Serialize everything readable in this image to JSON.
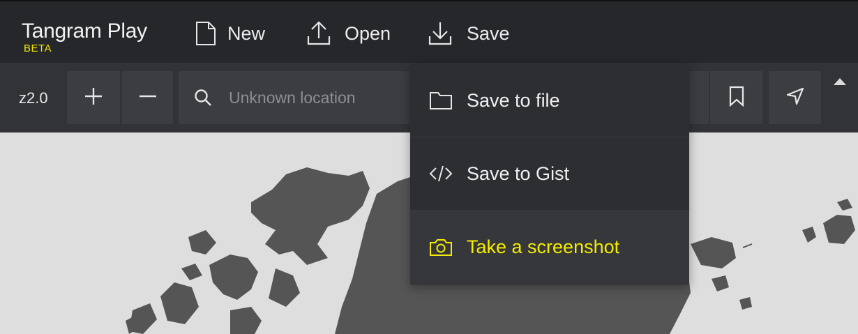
{
  "app": {
    "title": "Tangram Play",
    "badge": "BETA"
  },
  "menu": {
    "new_label": "New",
    "open_label": "Open",
    "save_label": "Save"
  },
  "toolbar": {
    "zoom": "z2.0",
    "search_placeholder": "Unknown location",
    "icons": [
      "plus-icon",
      "minus-icon",
      "search-icon",
      "bookmark-icon",
      "location-arrow-icon",
      "collapse-arrow-icon"
    ]
  },
  "save_menu": {
    "items": [
      {
        "label": "Save to file",
        "icon": "folder-icon"
      },
      {
        "label": "Save to Gist",
        "icon": "code-icon"
      },
      {
        "label": "Take a screenshot",
        "icon": "camera-icon",
        "highlighted": true
      }
    ]
  },
  "colors": {
    "accent": "#f5ec00",
    "bar": "#26272b",
    "toolbar": "#323336",
    "map_land": "#555555",
    "map_water": "#dedede"
  }
}
